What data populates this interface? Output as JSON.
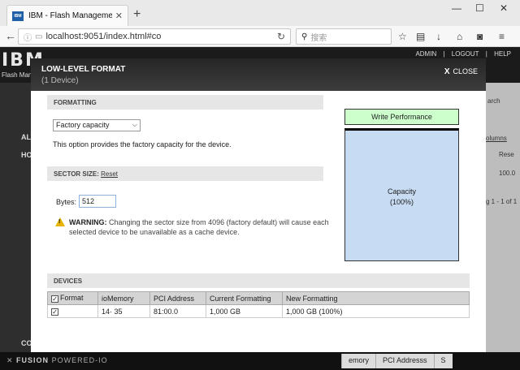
{
  "browser": {
    "tab_title": "IBM - Flash Manageme",
    "favicon_text": "IBM",
    "url": "localhost:9051/index.html#co",
    "search_placeholder": "搜索"
  },
  "app": {
    "logo": "IBM",
    "subtitle": "Flash Manag",
    "links": [
      "ADMIN",
      "|",
      "LOGOUT",
      "|",
      "HELP"
    ],
    "left_labels": [
      "AL",
      "HO",
      "CO"
    ],
    "right_cells": [
      "arch",
      "olumns",
      "Rese",
      "100.0",
      "g 1 - 1 of 1"
    ],
    "footer_brand": "FUSION",
    "footer_tag": "POWERED-IO",
    "footer_tabs": [
      "emory",
      "PCI Addresss",
      "S"
    ]
  },
  "modal": {
    "title": "LOW-LEVEL FORMAT",
    "subtitle": "(1 Device)",
    "close_label": "CLOSE",
    "close_x": "X",
    "formatting": {
      "section_label": "FORMATTING",
      "selected_option": "Factory capacity",
      "description": "This option provides the factory capacity for the device."
    },
    "sector": {
      "section_label": "SECTOR SIZE:",
      "reset_label": "Reset",
      "bytes_label": "Bytes:",
      "bytes_value": "512",
      "warning_title": "WARNING:",
      "warning_text": "Changing the sector size from 4096 (factory default) will cause each selected device to be unavailable as a cache device."
    },
    "performance": {
      "write_label": "Write Performance",
      "capacity_label": "Capacity",
      "capacity_pct": "(100%)"
    },
    "devices": {
      "section_label": "DEVICES",
      "columns": [
        "Format",
        "ioMemory",
        "PCI Address",
        "Current Formatting",
        "New Formatting"
      ],
      "rows": [
        {
          "checked": true,
          "iomemory": "14·    35",
          "pci": "81:00.0",
          "current": "1,000 GB",
          "new": "1,000 GB (100%)"
        }
      ]
    }
  },
  "colors": {
    "write_box": "#ccffcc",
    "capacity_box": "#c7dcf3",
    "warning": "#e8b400"
  }
}
